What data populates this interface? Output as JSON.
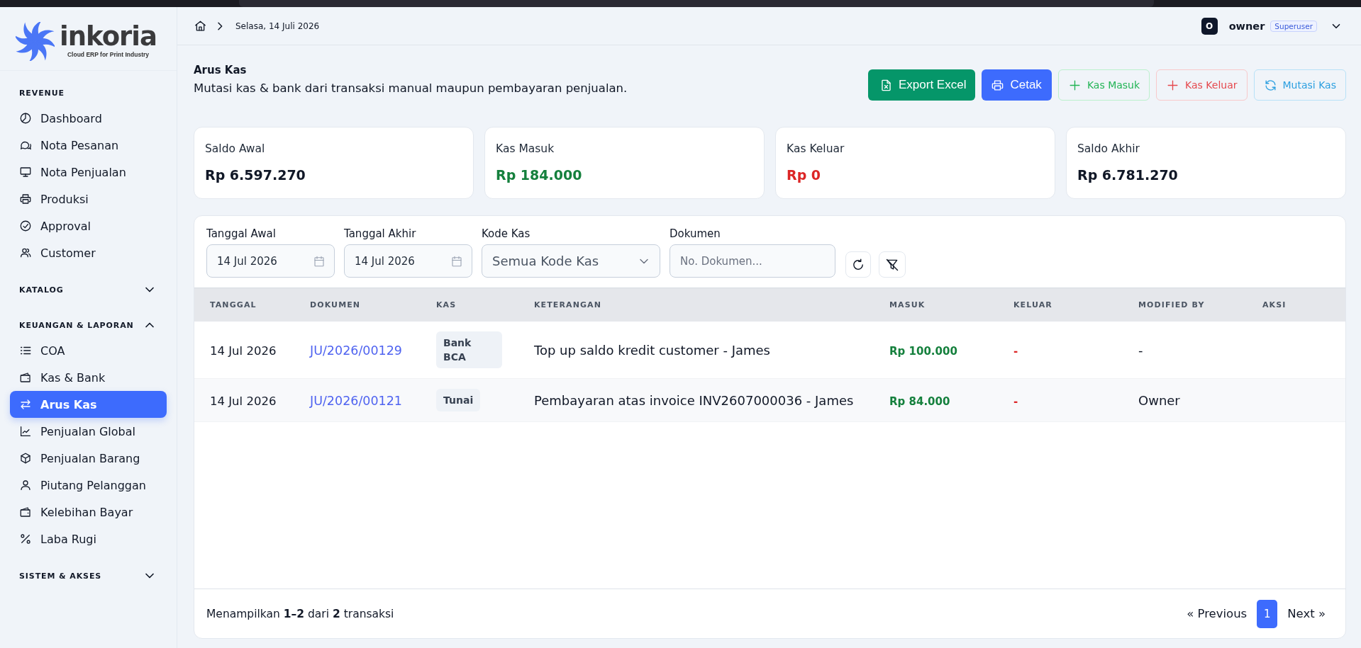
{
  "sidebar": {
    "logo": {
      "wordmark": "inkoria",
      "tagline": "Cloud ERP for Print Industry"
    },
    "sections": [
      {
        "title": "REVENUE",
        "collapsible": false,
        "items": [
          {
            "label": "Dashboard",
            "selected": false
          },
          {
            "label": "Nota Pesanan",
            "selected": false
          },
          {
            "label": "Nota Penjualan",
            "selected": false
          },
          {
            "label": "Produksi",
            "selected": false
          },
          {
            "label": "Approval",
            "selected": false
          },
          {
            "label": "Customer",
            "selected": false
          }
        ]
      },
      {
        "title": "KATALOG",
        "collapsible": true,
        "expanded": false
      },
      {
        "title": "KEUANGAN & LAPORAN",
        "collapsible": true,
        "expanded": true,
        "items": [
          {
            "label": "COA",
            "selected": false
          },
          {
            "label": "Kas & Bank",
            "selected": false
          },
          {
            "label": "Arus Kas",
            "selected": true
          },
          {
            "label": "Penjualan Global",
            "selected": false
          },
          {
            "label": "Penjualan Barang",
            "selected": false
          },
          {
            "label": "Piutang Pelanggan",
            "selected": false
          },
          {
            "label": "Kelebihan Bayar",
            "selected": false
          },
          {
            "label": "Laba Rugi",
            "selected": false
          }
        ]
      },
      {
        "title": "SISTEM & AKSES",
        "collapsible": true,
        "expanded": false
      }
    ]
  },
  "header": {
    "date": "Selasa, 14 Juli 2026",
    "user": {
      "initial": "O",
      "name": "owner",
      "role": "Superuser"
    }
  },
  "page": {
    "title": "Arus Kas",
    "subtitle": "Mutasi kas & bank dari transaksi manual maupun pembayaran penjualan.",
    "actions": [
      {
        "label": "Export Excel",
        "kind": "export"
      },
      {
        "label": "Cetak",
        "kind": "print"
      },
      {
        "label": "Kas Masuk",
        "kind": "in"
      },
      {
        "label": "Kas Keluar",
        "kind": "out"
      },
      {
        "label": "Mutasi Kas",
        "kind": "transfer"
      }
    ]
  },
  "summary": [
    {
      "label": "Saldo Awal",
      "value": "Rp 6.597.270",
      "kind": "balance"
    },
    {
      "label": "Kas Masuk",
      "value": "Rp 184.000",
      "kind": "in"
    },
    {
      "label": "Kas Keluar",
      "value": "Rp 0",
      "kind": "out"
    },
    {
      "label": "Saldo Akhir",
      "value": "Rp 6.781.270",
      "kind": "balance"
    }
  ],
  "filters": [
    {
      "label": "Tanggal Awal",
      "value": "14 Jul 2026",
      "kind": "date"
    },
    {
      "label": "Tanggal Akhir",
      "value": "14 Jul 2026",
      "kind": "date"
    },
    {
      "label": "Kode Kas",
      "value": "Semua Kode Kas",
      "kind": "select"
    },
    {
      "label": "Dokumen",
      "placeholder": "No. Dokumen...",
      "kind": "text"
    }
  ],
  "table": {
    "columns": [
      "TANGGAL",
      "DOKUMEN",
      "KAS",
      "KETERANGAN",
      "MASUK",
      "KELUAR",
      "MODIFIED BY",
      "AKSI"
    ],
    "rows": [
      {
        "tanggal": "14 Jul 2026",
        "dokumen": "JU/2026/00129",
        "kas": "Bank BCA",
        "keterangan": "Top up saldo kredit customer - James",
        "masuk": "Rp 100.000",
        "keluar": "-",
        "modified_by": "-"
      },
      {
        "tanggal": "14 Jul 2026",
        "dokumen": "JU/2026/00121",
        "kas": "Tunai",
        "keterangan": "Pembayaran atas invoice INV2607000036 - James",
        "masuk": "Rp 84.000",
        "keluar": "-",
        "modified_by": "Owner"
      }
    ]
  },
  "footer": {
    "summary": "Menampilkan **1–2** dari **2** transaksi",
    "previous": "« Previous",
    "pages": [
      {
        "label": "1",
        "selected": true
      }
    ],
    "next": "Next »"
  }
}
